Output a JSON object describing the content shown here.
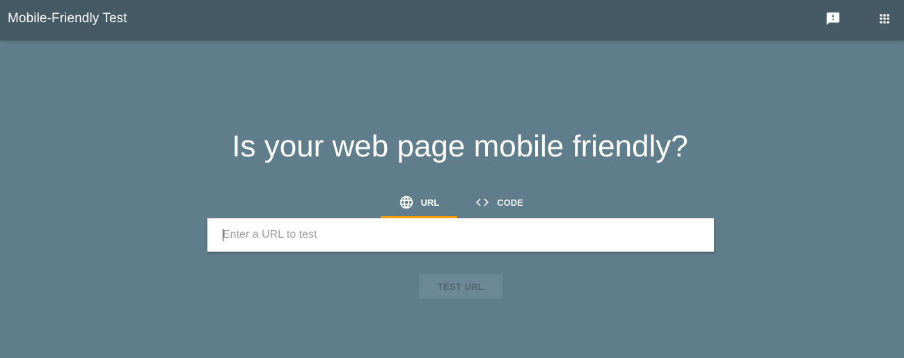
{
  "header": {
    "title": "Mobile-Friendly Test",
    "icons": [
      "feedback-icon",
      "apps-icon"
    ]
  },
  "main": {
    "headline": "Is your web page mobile friendly?",
    "tabs": [
      {
        "label": "URL",
        "icon": "globe-icon",
        "selected": true
      },
      {
        "label": "CODE",
        "icon": "code-icon",
        "selected": false
      }
    ],
    "url_input": {
      "placeholder": "Enter a URL to test",
      "value": ""
    },
    "test_button": {
      "label": "TEST URL",
      "enabled": false
    }
  },
  "colors": {
    "background": "#607d8b",
    "topbar": "#455a64",
    "tab_indicator": "#ffa000"
  }
}
